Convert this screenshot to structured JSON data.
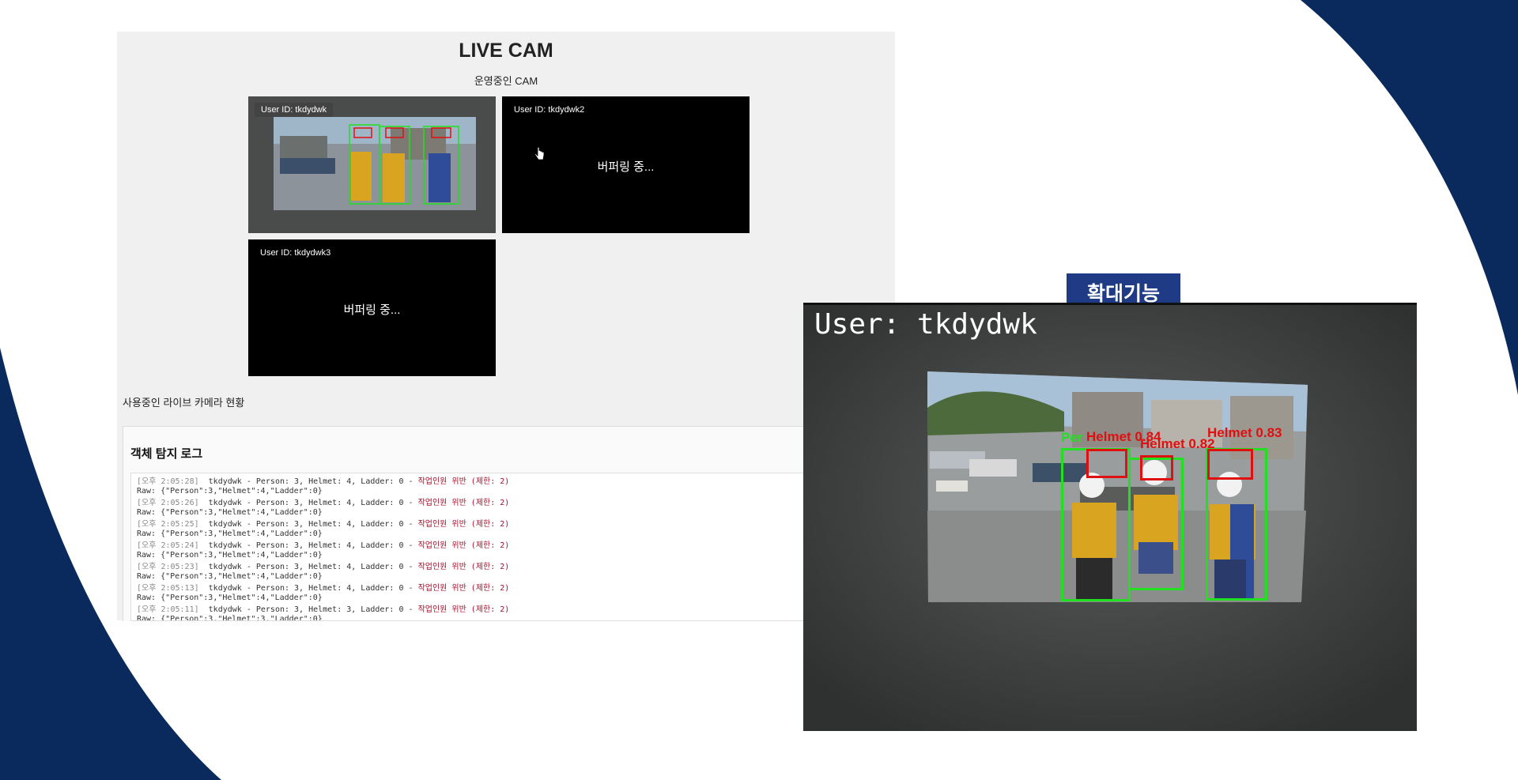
{
  "colors": {
    "background_navy": "#0a2a5e",
    "badge_blue": "#1f3b86",
    "warn_red": "#a8102e",
    "detect_green": "#20e020",
    "detect_red": "#e01010"
  },
  "live": {
    "title": "LIVE CAM",
    "subtitle": "운영중인 CAM",
    "cameras": [
      {
        "user_label": "User ID: tkdydwk",
        "status": "streaming"
      },
      {
        "user_label": "User ID: tkdydwk2",
        "status": "버퍼링 중..."
      },
      {
        "user_label": "User ID: tkdydwk3",
        "status": "버퍼링 중..."
      }
    ],
    "section_caption": "사용중인 라이브 카메라 현황"
  },
  "log": {
    "title": "객체 탐지 로그",
    "entries": [
      {
        "time": "[오후 2:05:28]",
        "main": "  tkdydwk - Person: 3, Helmet: 4, Ladder: 0 - ",
        "warn": "작업인원 위반 (제한: 2)",
        "raw": "Raw: {\"Person\":3,\"Helmet\":4,\"Ladder\":0}"
      },
      {
        "time": "[오후 2:05:26]",
        "main": "  tkdydwk - Person: 3, Helmet: 4, Ladder: 0 - ",
        "warn": "작업인원 위반 (제한: 2)",
        "raw": "Raw: {\"Person\":3,\"Helmet\":4,\"Ladder\":0}"
      },
      {
        "time": "[오후 2:05:25]",
        "main": "  tkdydwk - Person: 3, Helmet: 4, Ladder: 0 - ",
        "warn": "작업인원 위반 (제한: 2)",
        "raw": "Raw: {\"Person\":3,\"Helmet\":4,\"Ladder\":0}"
      },
      {
        "time": "[오후 2:05:24]",
        "main": "  tkdydwk - Person: 3, Helmet: 4, Ladder: 0 - ",
        "warn": "작업인원 위반 (제한: 2)",
        "raw": "Raw: {\"Person\":3,\"Helmet\":4,\"Ladder\":0}"
      },
      {
        "time": "[오후 2:05:23]",
        "main": "  tkdydwk - Person: 3, Helmet: 4, Ladder: 0 - ",
        "warn": "작업인원 위반 (제한: 2)",
        "raw": "Raw: {\"Person\":3,\"Helmet\":4,\"Ladder\":0}"
      },
      {
        "time": "[오후 2:05:13]",
        "main": "  tkdydwk - Person: 3, Helmet: 4, Ladder: 0 - ",
        "warn": "작업인원 위반 (제한: 2)",
        "raw": "Raw: {\"Person\":3,\"Helmet\":4,\"Ladder\":0}"
      },
      {
        "time": "[오후 2:05:11]",
        "main": "  tkdydwk - Person: 3, Helmet: 3, Ladder: 0 - ",
        "warn": "작업인원 위반 (제한: 2)",
        "raw": "Raw: {\"Person\":3,\"Helmet\":3,\"Ladder\":0}"
      }
    ]
  },
  "zoom": {
    "badge": "확대기능",
    "user_overlay": "User: tkdydwk",
    "detections": [
      {
        "label": "Helmet 0.84"
      },
      {
        "label": "Helmet 0.82"
      },
      {
        "label": "Helmet 0.83"
      }
    ]
  }
}
